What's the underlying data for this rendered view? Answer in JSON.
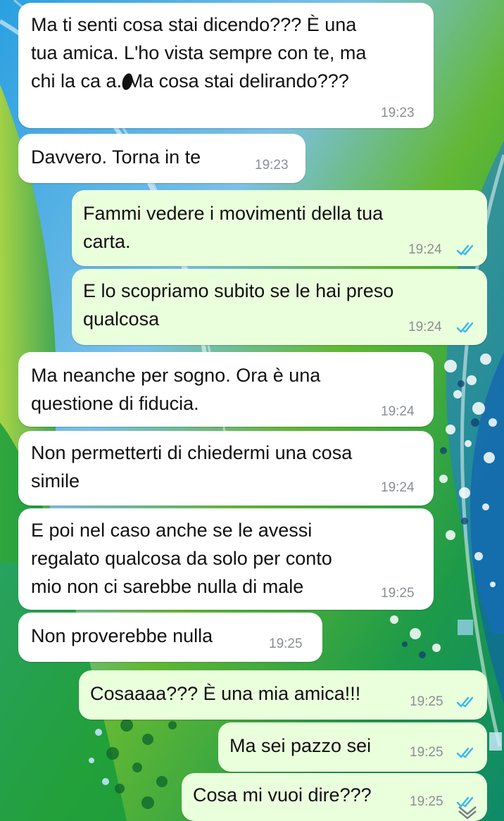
{
  "chat": {
    "messages": [
      {
        "direction": "in",
        "lines": [
          "Ma ti senti cosa stai dicendo??? È una",
          "tua amica. L'ho vista sempre con te, ma",
          "chi la ca  a. Ma cosa stai delirando???"
        ],
        "time": "19:23"
      },
      {
        "direction": "in",
        "lines": [
          "Davvero. Torna in te"
        ],
        "time": "19:23"
      },
      {
        "direction": "out",
        "lines": [
          "Fammi vedere i movimenti della tua",
          "carta."
        ],
        "time": "19:24",
        "status": "read"
      },
      {
        "direction": "out",
        "lines": [
          "E lo scopriamo subito se le hai preso",
          "qualcosa"
        ],
        "time": "19:24",
        "status": "read"
      },
      {
        "direction": "in",
        "lines": [
          "Ma neanche per sogno. Ora è una",
          "questione di fiducia."
        ],
        "time": "19:24"
      },
      {
        "direction": "in",
        "lines": [
          "Non permetterti di chiedermi una cosa",
          "simile"
        ],
        "time": "19:24"
      },
      {
        "direction": "in",
        "lines": [
          "E poi nel caso anche se le avessi",
          "regalato qualcosa da solo per conto",
          "mio non ci sarebbe nulla di male"
        ],
        "time": "19:25"
      },
      {
        "direction": "in",
        "lines": [
          "Non proverebbe nulla"
        ],
        "time": "19:25"
      },
      {
        "direction": "out",
        "lines": [
          "Cosaaaa??? È una mia amica!!!"
        ],
        "time": "19:25",
        "status": "read"
      },
      {
        "direction": "out",
        "lines": [
          "Ma sei pazzo sei"
        ],
        "time": "19:25",
        "status": "read"
      },
      {
        "direction": "out",
        "lines": [
          "Cosa mi vuoi dire???"
        ],
        "time": "19:25",
        "status": "read"
      }
    ]
  },
  "icons": {
    "read_ticks": "double-check-icon",
    "scroll_down": "chevron-down-icon"
  },
  "colors": {
    "incoming": "#ffffff",
    "outgoing": "#eaffdc",
    "ticks": "#34b7f1",
    "time": "#8a8f93"
  }
}
